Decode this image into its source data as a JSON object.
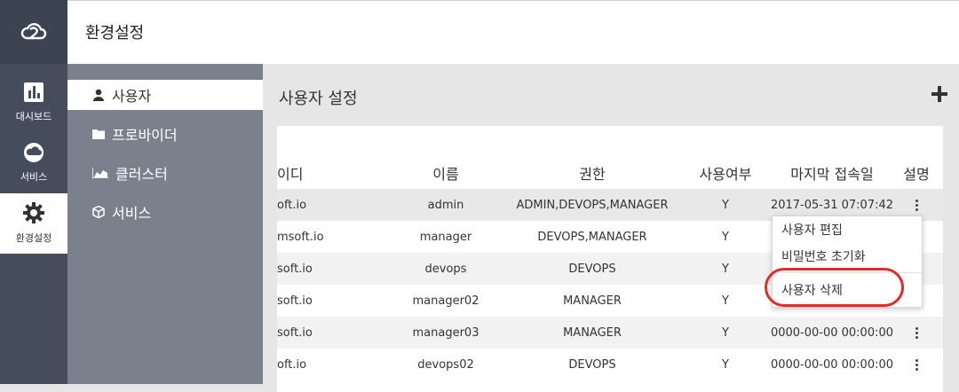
{
  "app": {
    "logo_icon": "cloud-logo-icon",
    "header_title": "환경설정"
  },
  "rail": {
    "items": [
      {
        "label": "대시보드",
        "icon": "bar-chart-icon"
      },
      {
        "label": "서비스",
        "icon": "cloud-icon"
      },
      {
        "label": "환경설정",
        "icon": "gear-icon",
        "active": true
      }
    ]
  },
  "submenu": {
    "items": [
      {
        "label": "사용자",
        "icon": "user-icon",
        "active": true
      },
      {
        "label": "프로바이더",
        "icon": "folder-icon"
      },
      {
        "label": "클러스터",
        "icon": "area-chart-icon"
      },
      {
        "label": "서비스",
        "icon": "cube-icon"
      }
    ]
  },
  "main": {
    "title": "사용자 설정",
    "add_icon": "plus-icon",
    "columns": [
      "이디",
      "이름",
      "권한",
      "사용여부",
      "마지막 접속일",
      "설명"
    ],
    "rows": [
      {
        "id": "oft.io",
        "name": "admin",
        "role": "ADMIN,DEVOPS,MANAGER",
        "enabled": "Y",
        "last_login": "2017-05-31 07:07:42"
      },
      {
        "id": "msoft.io",
        "name": "manager",
        "role": "DEVOPS,MANAGER",
        "enabled": "Y",
        "last_login": ""
      },
      {
        "id": "soft.io",
        "name": "devops",
        "role": "DEVOPS",
        "enabled": "Y",
        "last_login": ""
      },
      {
        "id": "soft.io",
        "name": "manager02",
        "role": "MANAGER",
        "enabled": "Y",
        "last_login": ""
      },
      {
        "id": "soft.io",
        "name": "manager03",
        "role": "MANAGER",
        "enabled": "Y",
        "last_login": "0000-00-00 00:00:00"
      },
      {
        "id": "oft.io",
        "name": "devops02",
        "role": "DEVOPS",
        "enabled": "Y",
        "last_login": "0000-00-00 00:00:00"
      }
    ]
  },
  "context_menu": {
    "items": [
      "사용자 편집",
      "비밀번호 초기화",
      "사용자 삭제"
    ],
    "highlight_color": "#e32b2b"
  },
  "colors": {
    "rail_bg": "#454d5c",
    "submenu_bg": "#7b818c",
    "main_bg": "#e6e6e6"
  }
}
